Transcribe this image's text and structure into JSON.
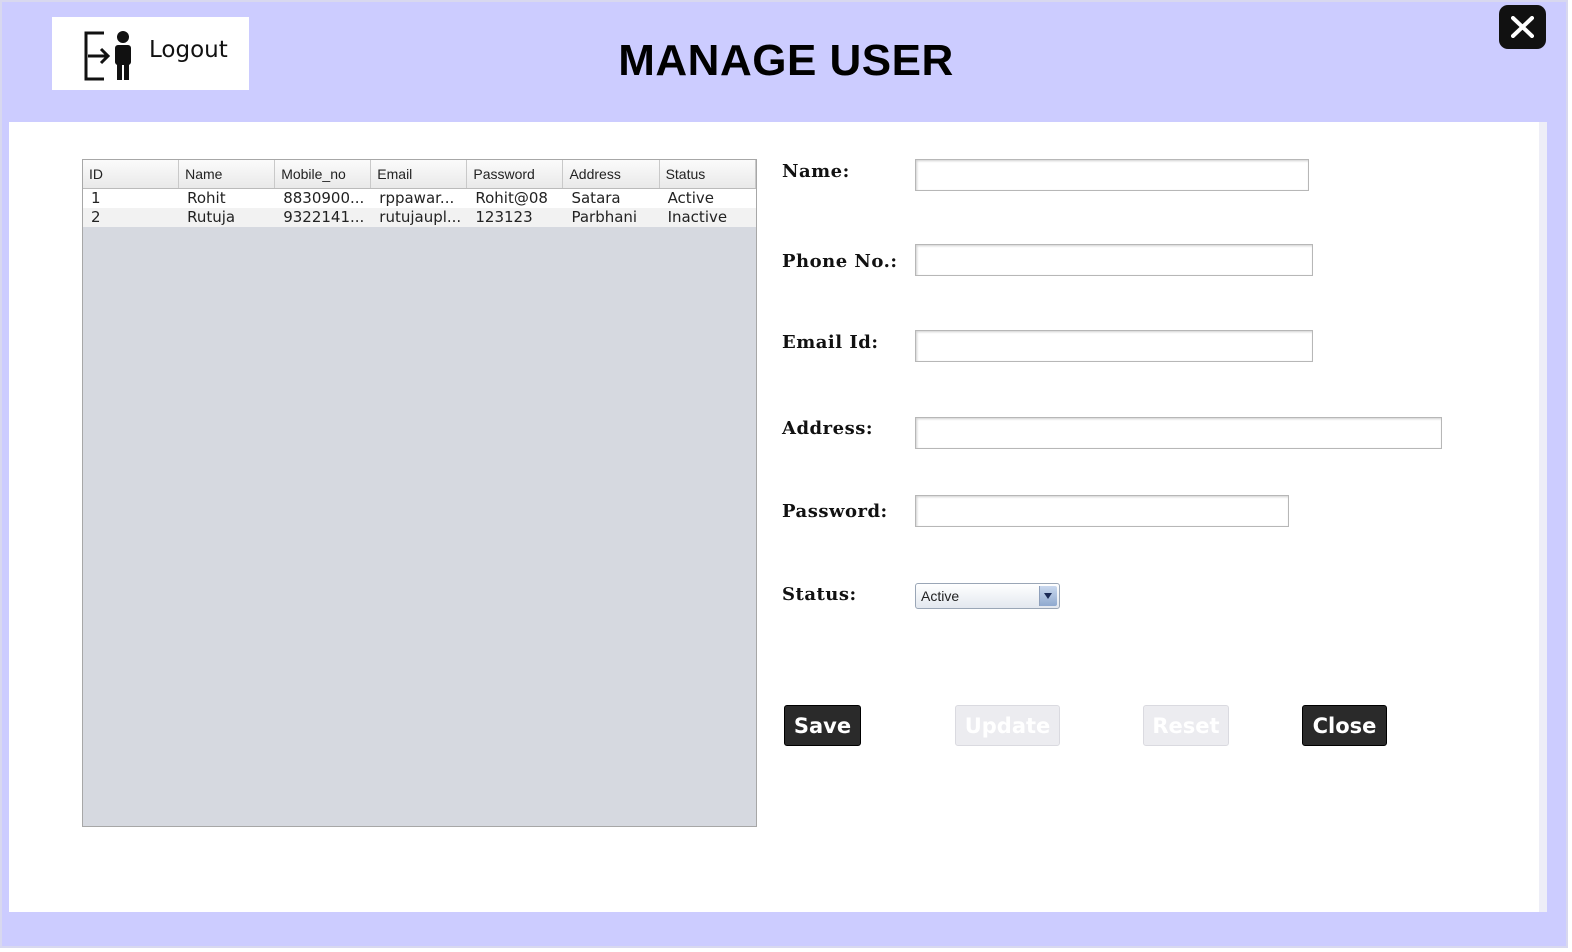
{
  "header": {
    "logout_label": "Logout",
    "title": "MANAGE USER",
    "close_icon": "close-icon",
    "logout_icon": "logout-person-icon"
  },
  "table": {
    "columns": [
      "ID",
      "Name",
      "Mobile_no",
      "Email",
      "Password",
      "Address",
      "Status"
    ],
    "rows": [
      [
        "1",
        "Rohit",
        "8830900...",
        "rppawar...",
        "Rohit@08",
        "Satara",
        "Active"
      ],
      [
        "2",
        "Rutuja",
        "9322141...",
        "rutujaupl...",
        "123123",
        "Parbhani",
        "Inactive"
      ]
    ]
  },
  "form": {
    "name_label": "Name:",
    "phone_label": "Phone No.:",
    "email_label": "Email Id:",
    "address_label": "Address:",
    "password_label": "Password:",
    "status_label": "Status:",
    "name_value": "",
    "phone_value": "",
    "email_value": "",
    "address_value": "",
    "password_value": "",
    "status_selected": "Active"
  },
  "buttons": {
    "save": "Save",
    "update": "Update",
    "reset": "Reset",
    "close": "Close"
  },
  "colors": {
    "frame_bg": "#ccccff",
    "button_dark": "#2a2a2a",
    "button_disabled": "#ececf0"
  }
}
